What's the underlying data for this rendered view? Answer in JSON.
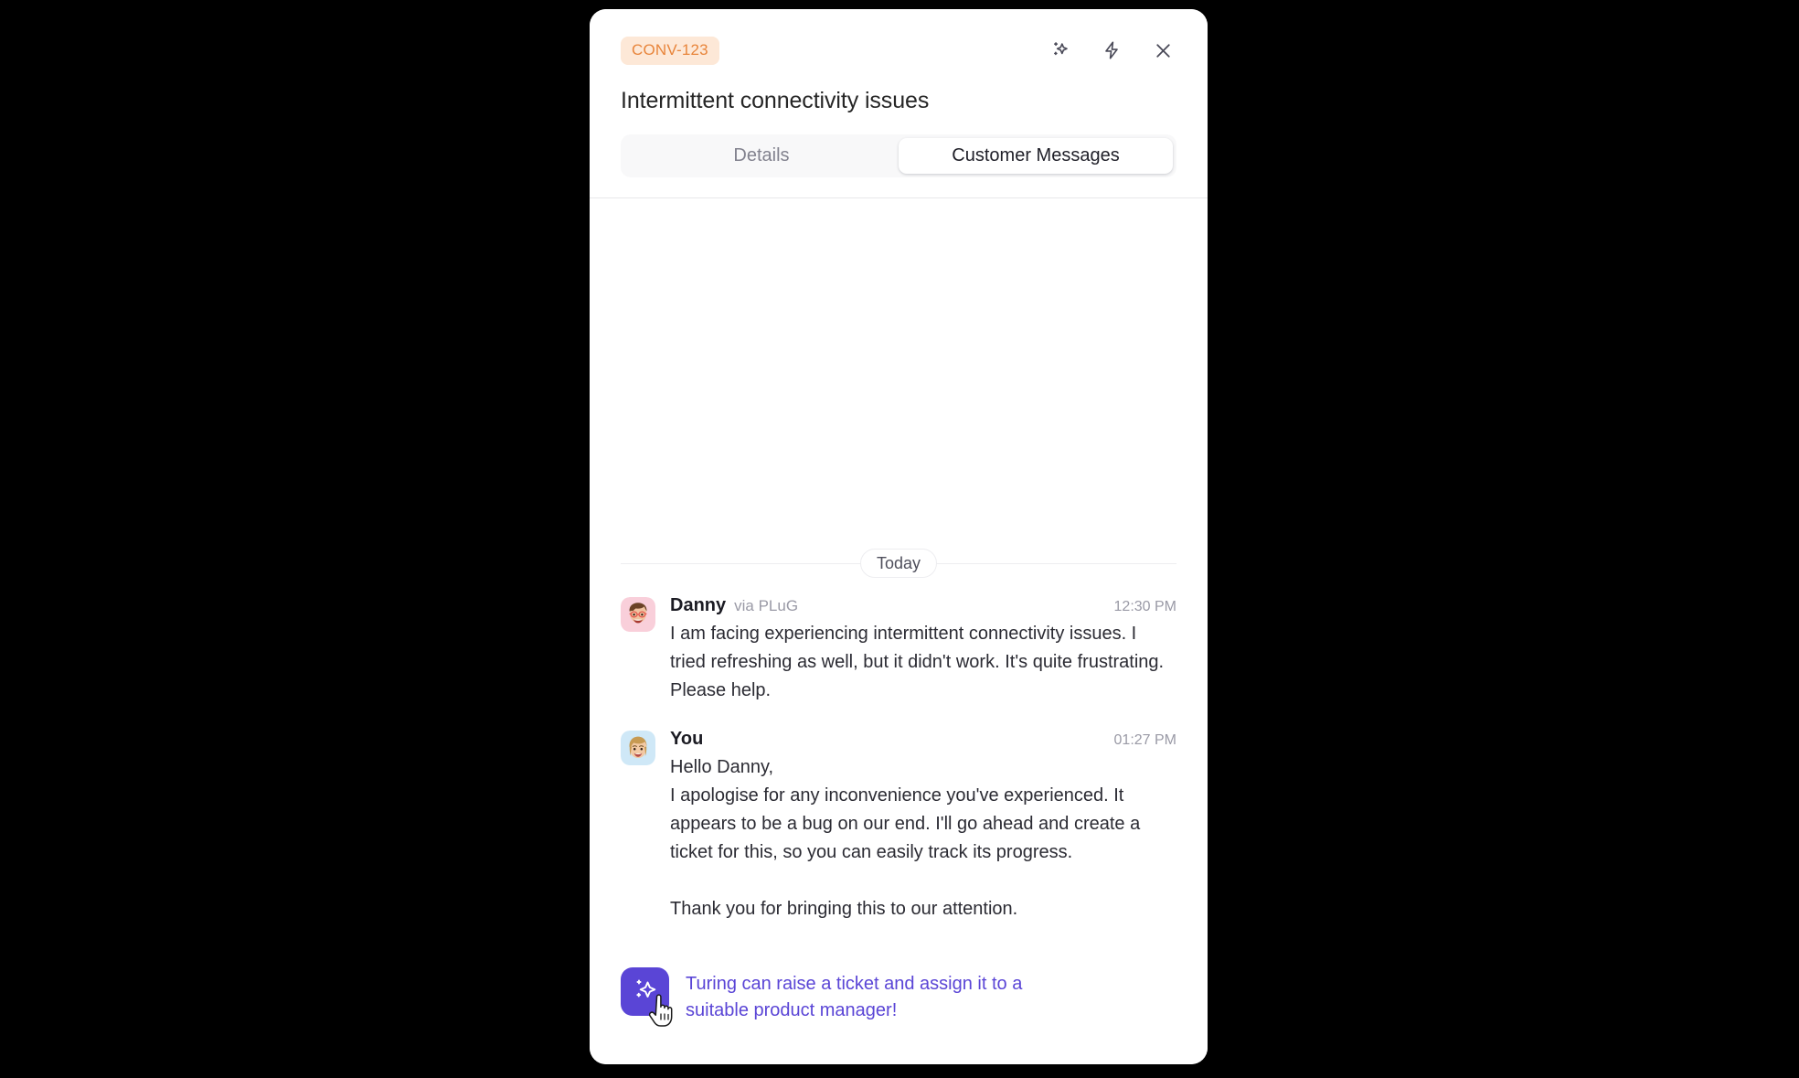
{
  "header": {
    "badge": "CONV-123",
    "title": "Intermittent connectivity issues",
    "actions": [
      {
        "name": "sparkle-icon",
        "label": "AI assist"
      },
      {
        "name": "zap-icon",
        "label": "Quick actions"
      },
      {
        "name": "close-icon",
        "label": "Close"
      }
    ]
  },
  "tabs": [
    {
      "label": "Details",
      "active": false
    },
    {
      "label": "Customer Messages",
      "active": true
    }
  ],
  "conversation": {
    "day_divider": "Today",
    "messages": [
      {
        "author": "Danny",
        "via": "via PLuG",
        "time": "12:30 PM",
        "text": "I am facing experiencing intermittent connectivity issues. I tried refreshing as well, but it didn't work. It's quite frustrating. Please help.",
        "avatar": "danny-avatar",
        "avatar_bg": "#f9cfda"
      },
      {
        "author": "You",
        "via": "",
        "time": "01:27 PM",
        "text": "Hello Danny,\nI apologise for any inconvenience you've experienced. It appears to be a bug on our end. I'll go ahead and create a ticket for this, so you can easily track its progress.\n\nThank you for bringing this to our attention.",
        "avatar": "you-avatar",
        "avatar_bg": "#cfe8f7"
      }
    ]
  },
  "ai_suggestion": {
    "text": "Turing can raise a ticket and assign it to a suitable product manager!",
    "button_icon": "sparkle-icon"
  },
  "colors": {
    "badge_bg": "#fde8d7",
    "badge_text": "#e8853b",
    "accent_purple": "#5a45d6",
    "panel_bg": "#ffffff",
    "backdrop": "#000000",
    "muted_text": "#9a9aa6"
  }
}
